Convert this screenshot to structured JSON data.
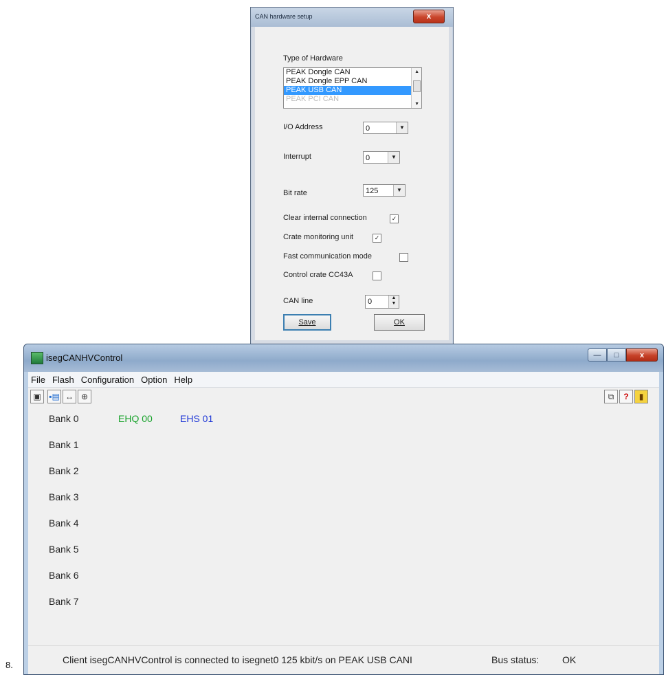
{
  "dialog": {
    "title": "CAN hardware setup",
    "close_glyph": "x",
    "hardware_label": "Type of Hardware",
    "hardware_list": [
      "PEAK Dongle CAN",
      "PEAK Dongle EPP CAN",
      "PEAK USB CAN",
      "PEAK PCI CAN"
    ],
    "hardware_selected_index": 2,
    "io_address_label": "I/O Address",
    "io_address_value": "0",
    "interrupt_label": "Interrupt",
    "interrupt_value": "0",
    "bitrate_label": "Bit rate",
    "bitrate_value": "125",
    "options": [
      {
        "label": "Clear internal connection",
        "checked": true
      },
      {
        "label": "Crate monitoring unit",
        "checked": true
      },
      {
        "label": "Fast communication mode",
        "checked": false
      },
      {
        "label": "Control crate CC43A",
        "checked": false
      }
    ],
    "can_line_label": "CAN line",
    "can_line_value": "0",
    "save_label": "Save",
    "ok_label": "OK"
  },
  "window": {
    "title": "isegCANHVControl",
    "menu": [
      "File",
      "Flash",
      "Configuration",
      "Option",
      "Help"
    ],
    "banks": [
      {
        "label": "Bank 0",
        "modules": [
          "EHQ 00",
          "EHS 01"
        ]
      },
      {
        "label": "Bank 1",
        "modules": []
      },
      {
        "label": "Bank 2",
        "modules": []
      },
      {
        "label": "Bank 3",
        "modules": []
      },
      {
        "label": "Bank 4",
        "modules": []
      },
      {
        "label": "Bank 5",
        "modules": []
      },
      {
        "label": "Bank 6",
        "modules": []
      },
      {
        "label": "Bank 7",
        "modules": []
      }
    ],
    "status": {
      "text": "Client isegCANHVControl is connected to isegnet0 125 kbit/s on PEAK USB CANI",
      "bus_label": "Bus status:",
      "bus_value": "OK"
    }
  },
  "caption": "8.",
  "colors": {
    "module_ehq": "#17a22a",
    "module_ehs": "#1c35d6",
    "selection": "#3399ff"
  }
}
